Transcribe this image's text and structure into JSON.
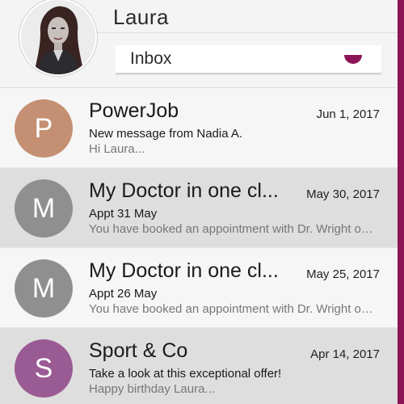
{
  "header": {
    "user_name": "Laura",
    "folder": "Inbox"
  },
  "colors": {
    "accent": "#8c1557"
  },
  "messages": [
    {
      "initial": "P",
      "avatar_color": "#c48f72",
      "sender": "PowerJob",
      "date": "Jun 1, 2017",
      "subject": "New message from Nadia A.",
      "preview": "Hi Laura..."
    },
    {
      "initial": "M",
      "avatar_color": "#8f8f8f",
      "sender": "My Doctor in one cl...",
      "date": "May 30, 2017",
      "subject": "Appt 31 May",
      "preview": "You have booked an appointment with Dr. Wright on ..."
    },
    {
      "initial": "M",
      "avatar_color": "#8f8f8f",
      "sender": "My Doctor in one cl...",
      "date": "May 25, 2017",
      "subject": "Appt 26 May",
      "preview": "You have booked an appointment with Dr. Wright on ..."
    },
    {
      "initial": "S",
      "avatar_color": "#9a5a93",
      "sender": "Sport & Co",
      "date": "Apr 14, 2017",
      "subject": "Take a look at this exceptional offer!",
      "preview": "Happy birthday Laura..."
    }
  ]
}
